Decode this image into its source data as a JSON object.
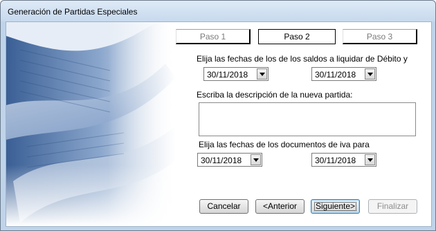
{
  "window": {
    "title": "Generación de Partidas Especiales"
  },
  "tabs": [
    {
      "label": "Paso 1",
      "state": "inactive"
    },
    {
      "label": "Paso 2",
      "state": "active"
    },
    {
      "label": "Paso 3",
      "state": "inactive"
    }
  ],
  "section1": {
    "label": "Elija las fechas de los de los saldos a liquidar de Débito y",
    "date_from": "30/11/2018",
    "date_to": "30/11/2018"
  },
  "section2": {
    "label": "Escriba la descripción de la nueva partida:",
    "description": ""
  },
  "section3": {
    "label": "Elija las fechas de los documentos de iva para",
    "date_from": "30/11/2018",
    "date_to": "30/11/2018"
  },
  "buttons": {
    "cancel": "Cancelar",
    "back": "<Anterior",
    "next": "Siguiente>",
    "finish": "Finalizar"
  },
  "icons": {
    "dropdown": "chevron-down-icon"
  }
}
